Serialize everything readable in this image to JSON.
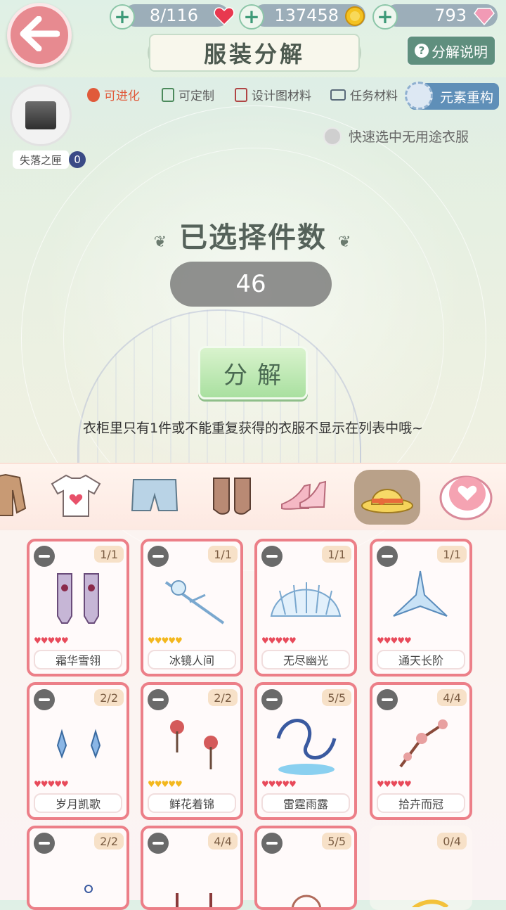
{
  "resources": {
    "stamina": "8/116",
    "gold": "137458",
    "diamonds": "793"
  },
  "header": {
    "title": "服装分解",
    "help_label": "分解说明"
  },
  "filters": [
    {
      "label": "可进化",
      "color": "#e05a3a"
    },
    {
      "label": "可定制",
      "color": "#4c8a5c"
    },
    {
      "label": "设计图材料",
      "color": "#b04545"
    },
    {
      "label": "任务材料",
      "color": "#5a6a7a"
    }
  ],
  "element_rebuild_label": "元素重构",
  "lost_box": {
    "label": "失落之匣",
    "count": "0"
  },
  "quick_select_label": "快速选中无用途衣服",
  "selected": {
    "title": "已选择件数",
    "count": "46"
  },
  "decompose_label": "分解",
  "notice": "衣柜里只有1件或不能重复获得的衣服不显示在列表中哦~",
  "categories": [
    {
      "icon": "coat-icon",
      "active": false
    },
    {
      "icon": "tshirt-icon",
      "active": false
    },
    {
      "icon": "shorts-icon",
      "active": false
    },
    {
      "icon": "socks-icon",
      "active": false
    },
    {
      "icon": "heels-icon",
      "active": false
    },
    {
      "icon": "hat-icon",
      "active": true
    },
    {
      "icon": "blush-icon",
      "active": false
    }
  ],
  "items": [
    {
      "name": "霜华雪翎",
      "count": "1/1",
      "stars": "red"
    },
    {
      "name": "冰镜人间",
      "count": "1/1",
      "stars": "gold"
    },
    {
      "name": "无尽幽光",
      "count": "1/1",
      "stars": "red"
    },
    {
      "name": "通天长阶",
      "count": "1/1",
      "stars": "red"
    },
    {
      "name": "岁月凯歌",
      "count": "2/2",
      "stars": "red"
    },
    {
      "name": "鲜花着锦",
      "count": "2/2",
      "stars": "gold"
    },
    {
      "name": "雷霆雨露",
      "count": "5/5",
      "stars": "red"
    },
    {
      "name": "拾卉而冠",
      "count": "4/4",
      "stars": "red"
    },
    {
      "name": "",
      "count": "2/2",
      "stars": ""
    },
    {
      "name": "",
      "count": "4/4",
      "stars": ""
    },
    {
      "name": "",
      "count": "5/5",
      "stars": ""
    },
    {
      "name": "",
      "count": "0/4",
      "stars": ""
    }
  ],
  "star_glyphs": "♥♥♥♥♥",
  "colors": {
    "card_border": "#ec7f88",
    "back_button": "#e78a90",
    "decompose_button": "#a9e0a0"
  }
}
